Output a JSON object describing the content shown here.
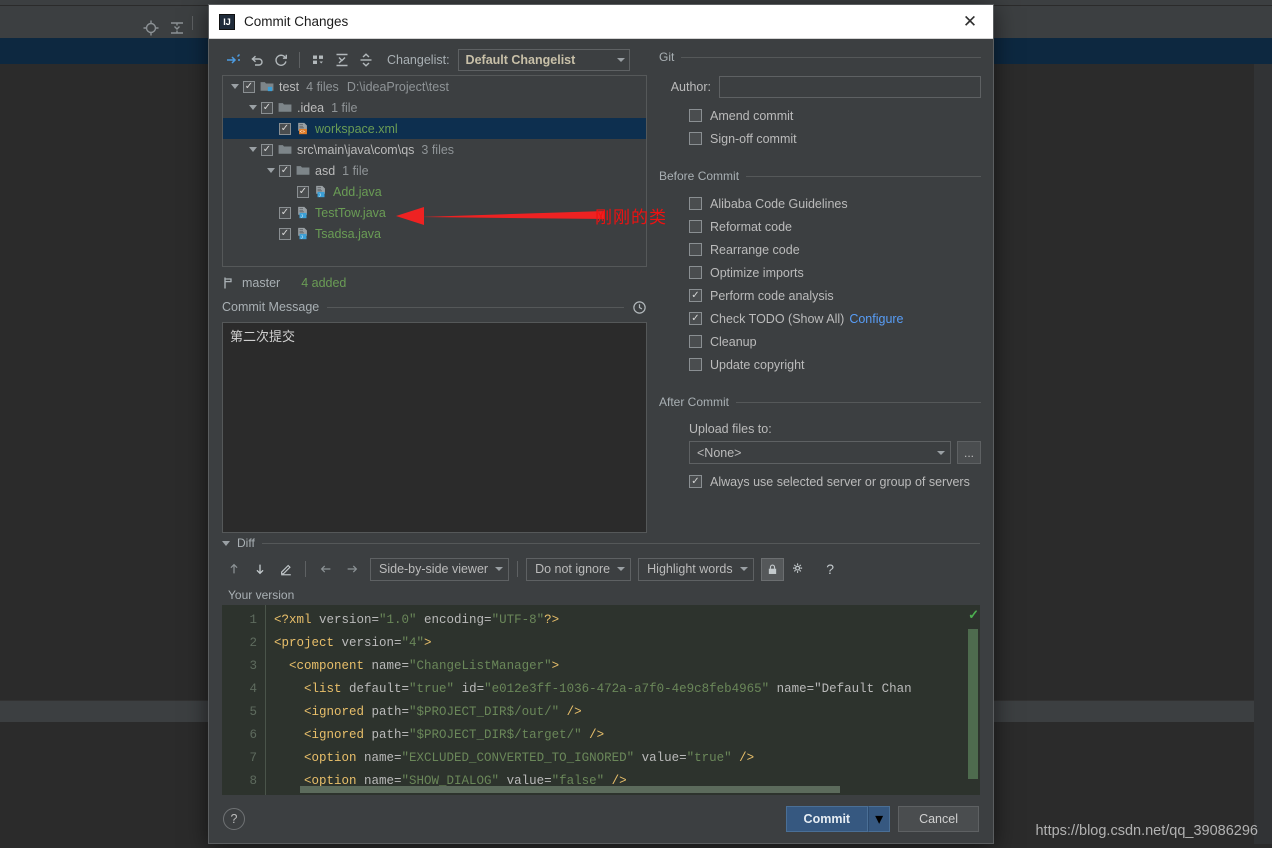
{
  "dialog": {
    "title": "Commit Changes",
    "title_icon": "intellij-idea-icon",
    "close_label": "✕"
  },
  "toolbar": {
    "changelist_label": "Changelist:",
    "changelist_value": "Default Changelist",
    "buttons": [
      {
        "name": "show-diff-icon",
        "tip": "Show Diff"
      },
      {
        "name": "revert-icon",
        "tip": "Revert"
      },
      {
        "name": "refresh-icon",
        "tip": "Refresh"
      },
      {
        "name": "group-by-icon",
        "tip": "Group By"
      },
      {
        "name": "expand-all-icon",
        "tip": "Expand All"
      },
      {
        "name": "collapse-all-icon",
        "tip": "Collapse All"
      }
    ]
  },
  "tree": {
    "rows": [
      {
        "indent": 0,
        "twisty": true,
        "checked": true,
        "icon": "folder-module-icon",
        "name": "test",
        "count": "4 files",
        "path": "D:\\ideaProject\\test",
        "selected": false,
        "color": "default"
      },
      {
        "indent": 1,
        "twisty": true,
        "checked": true,
        "icon": "folder-icon",
        "name": ".idea",
        "count": "1 file",
        "path": "",
        "selected": false,
        "color": "default"
      },
      {
        "indent": 2,
        "twisty": false,
        "checked": true,
        "icon": "xml-file-icon",
        "name": "workspace.xml",
        "count": "",
        "path": "",
        "selected": true,
        "color": "green"
      },
      {
        "indent": 1,
        "twisty": true,
        "checked": true,
        "icon": "folder-icon",
        "name": "src\\main\\java\\com\\qs",
        "count": "3 files",
        "path": "",
        "selected": false,
        "color": "default"
      },
      {
        "indent": 2,
        "twisty": true,
        "checked": true,
        "icon": "folder-icon",
        "name": "asd",
        "count": "1 file",
        "path": "",
        "selected": false,
        "color": "default"
      },
      {
        "indent": 3,
        "twisty": false,
        "checked": true,
        "icon": "java-file-icon",
        "name": "Add.java",
        "count": "",
        "path": "",
        "selected": false,
        "color": "green"
      },
      {
        "indent": 2,
        "twisty": false,
        "checked": true,
        "icon": "java-file-icon",
        "name": "TestTow.java",
        "count": "",
        "path": "",
        "selected": false,
        "color": "green"
      },
      {
        "indent": 2,
        "twisty": false,
        "checked": true,
        "icon": "java-file-icon",
        "name": "Tsadsa.java",
        "count": "",
        "path": "",
        "selected": false,
        "color": "green"
      }
    ]
  },
  "branch_bar": {
    "icon": "branch-icon",
    "branch": "master",
    "status": "4 added"
  },
  "commit_message": {
    "label": "Commit Message",
    "history_icon": "history-clock-icon",
    "value": "第二次提交",
    "placeholder": ""
  },
  "git_group": {
    "title": "Git",
    "author_label": "Author:",
    "author_value": "",
    "checkboxes": [
      {
        "label": "Amend commit",
        "checked": false
      },
      {
        "label": "Sign-off commit",
        "checked": false
      }
    ]
  },
  "before_commit": {
    "title": "Before Commit",
    "checkboxes": [
      {
        "label": "Alibaba Code Guidelines",
        "checked": false
      },
      {
        "label": "Reformat code",
        "checked": false
      },
      {
        "label": "Rearrange code",
        "checked": false
      },
      {
        "label": "Optimize imports",
        "checked": false
      },
      {
        "label": "Perform code analysis",
        "checked": true
      },
      {
        "label": "Check TODO (Show All)",
        "checked": true,
        "link": "Configure"
      },
      {
        "label": "Cleanup",
        "checked": false
      },
      {
        "label": "Update copyright",
        "checked": false
      }
    ]
  },
  "after_commit": {
    "title": "After Commit",
    "upload_label": "Upload files to:",
    "upload_value": "<None>",
    "browse_label": "...",
    "always_use": {
      "label": "Always use selected server or group of servers",
      "checked": true
    }
  },
  "diff": {
    "title": "Diff",
    "your_version_label": "Your version",
    "buttons": [
      {
        "name": "previous-difference-icon"
      },
      {
        "name": "next-difference-icon"
      },
      {
        "name": "edit-source-icon"
      },
      {
        "name": "accept-left-icon"
      },
      {
        "name": "accept-right-icon"
      }
    ],
    "viewer_mode": "Side-by-side viewer",
    "ignore_mode": "Do not ignore",
    "highlight_mode": "Highlight words",
    "lock_icon": "lock-icon",
    "settings_icon": "gear-icon",
    "help_icon": "question-mark-icon",
    "code_lines": [
      {
        "n": "1",
        "text": "<?xml version=\"1.0\" encoding=\"UTF-8\"?>"
      },
      {
        "n": "2",
        "text": "<project version=\"4\">"
      },
      {
        "n": "3",
        "text": "  <component name=\"ChangeListManager\">"
      },
      {
        "n": "4",
        "text": "    <list default=\"true\" id=\"e012e3ff-1036-472a-a7f0-4e9c8feb4965\" name=\"Default Chan"
      },
      {
        "n": "5",
        "text": "    <ignored path=\"$PROJECT_DIR$/out/\" />"
      },
      {
        "n": "6",
        "text": "    <ignored path=\"$PROJECT_DIR$/target/\" />"
      },
      {
        "n": "7",
        "text": "    <option name=\"EXCLUDED_CONVERTED_TO_IGNORED\" value=\"true\" />"
      },
      {
        "n": "8",
        "text": "    <option name=\"SHOW_DIALOG\" value=\"false\" />"
      }
    ]
  },
  "footer": {
    "help_label": "?",
    "commit_label": "Commit",
    "commit_dropdown": "▾",
    "cancel_label": "Cancel"
  },
  "annotation": {
    "text": "刚刚的类",
    "color": "#ee1111"
  },
  "watermark": {
    "text": "https://blog.csdn.net/qq_39086296"
  },
  "colors": {
    "dialog_bg": "#3c3f41",
    "ide_bg": "#2b2b2b",
    "accent_blue": "#365880",
    "selection_blue": "#0d2f4f",
    "added_green": "#6a9c55",
    "link_blue": "#589df6",
    "diff_green_bg": "#2d332d",
    "annotation_red": "#ee1111"
  }
}
